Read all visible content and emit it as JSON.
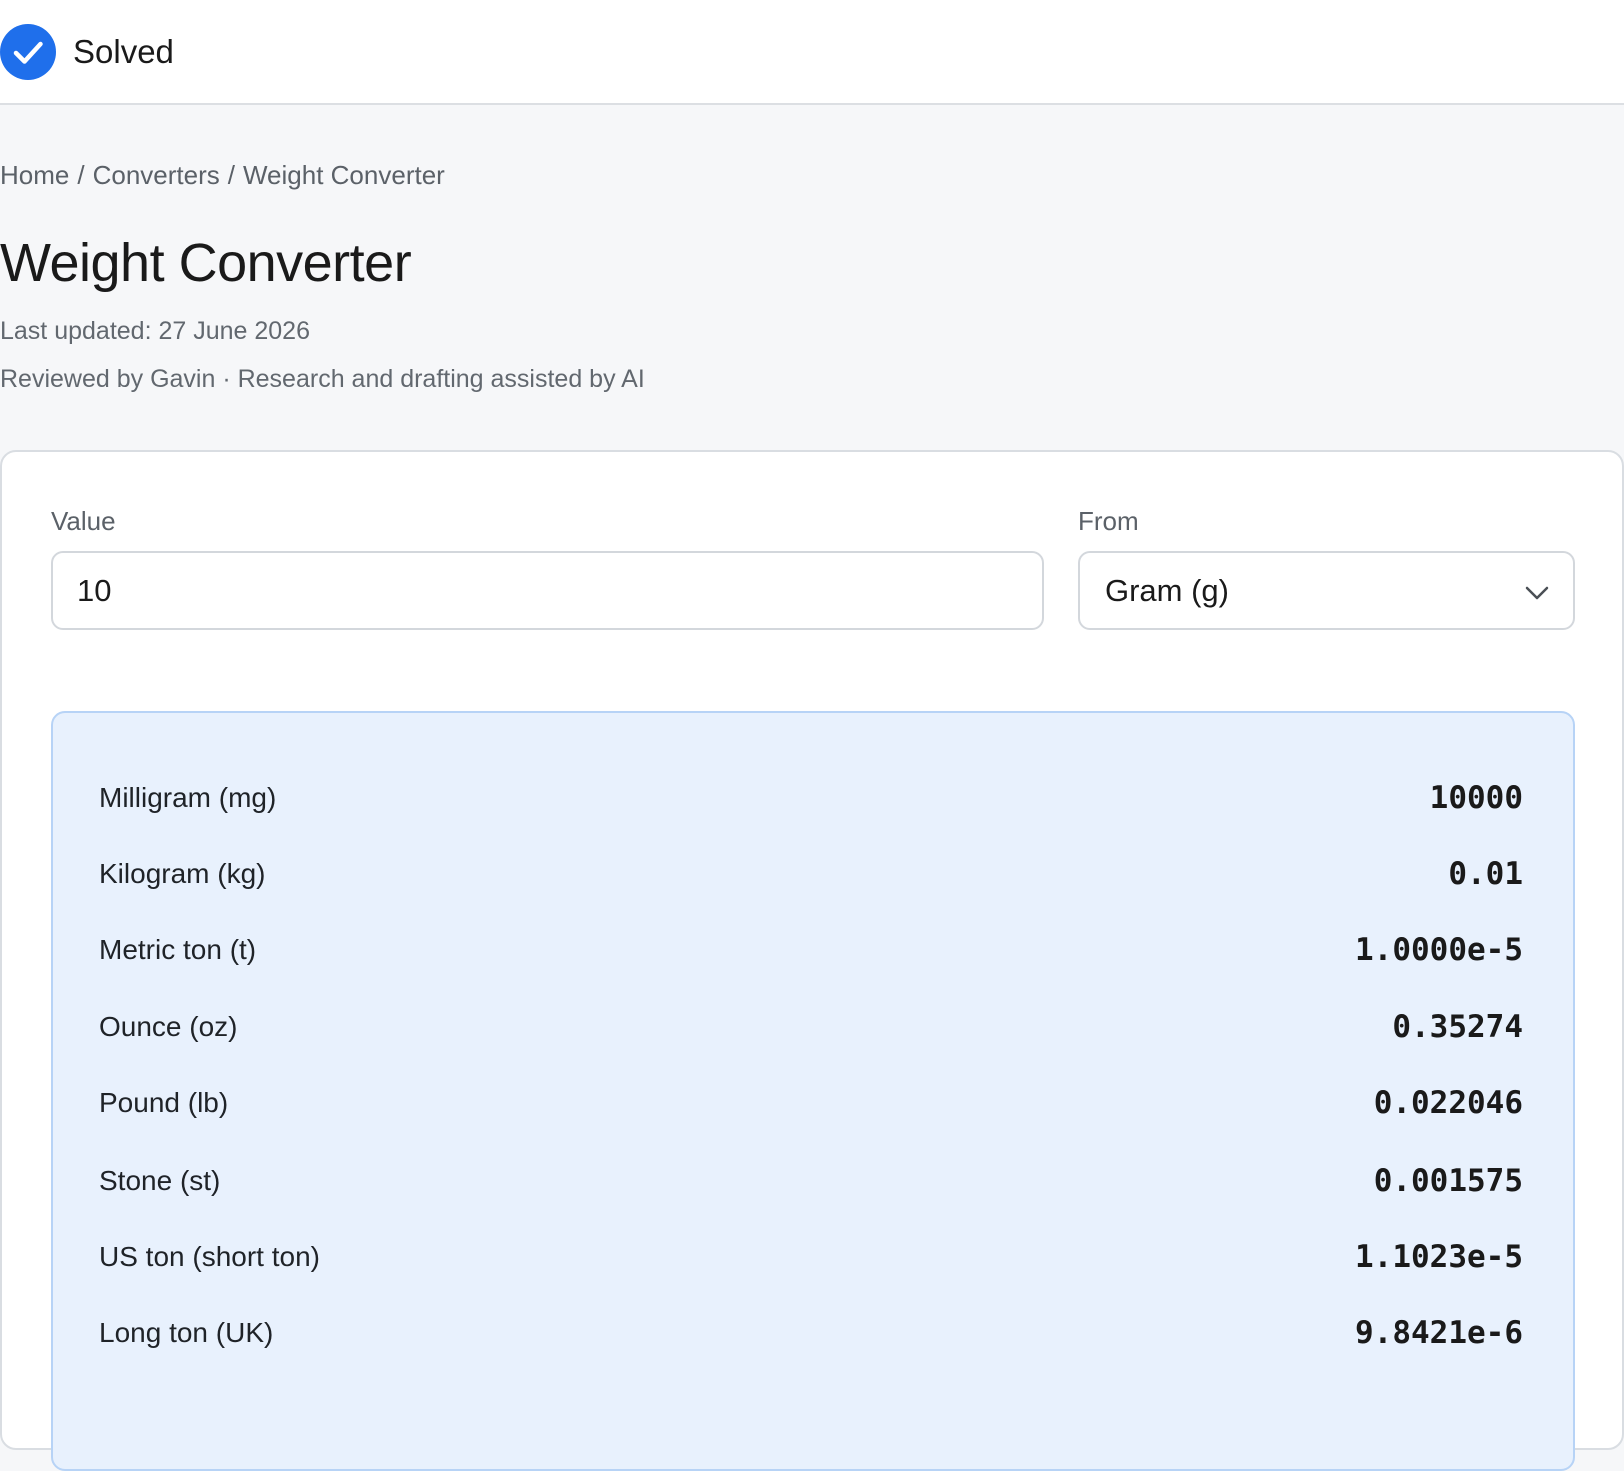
{
  "status": {
    "label": "Solved",
    "icon": "check-circle-icon",
    "color": "#1f6feb"
  },
  "breadcrumb": {
    "items": [
      "Home",
      "Converters",
      "Weight Converter"
    ],
    "separator": "/"
  },
  "page": {
    "title": "Weight Converter",
    "last_updated": "Last updated: 27 June 2026",
    "reviewed": "Reviewed by Gavin · Research and drafting assisted by AI"
  },
  "form": {
    "value_label": "Value",
    "value": "10",
    "from_label": "From",
    "from_selected": "Gram (g)",
    "from_icon": "chevron-down-icon"
  },
  "results": [
    {
      "unit": "Milligram (mg)",
      "value": "10000"
    },
    {
      "unit": "Kilogram (kg)",
      "value": "0.01"
    },
    {
      "unit": "Metric ton (t)",
      "value": "1.0000e-5"
    },
    {
      "unit": "Ounce (oz)",
      "value": "0.35274"
    },
    {
      "unit": "Pound (lb)",
      "value": "0.022046"
    },
    {
      "unit": "Stone (st)",
      "value": "0.001575"
    },
    {
      "unit": "US ton (short ton)",
      "value": "1.1023e-5"
    },
    {
      "unit": "Long ton (UK)",
      "value": "9.8421e-6"
    }
  ],
  "colors": {
    "accent": "#1f6feb",
    "results_bg": "#e8f1fd",
    "results_border": "#b7d3f6",
    "page_bg": "#f6f7f9"
  }
}
